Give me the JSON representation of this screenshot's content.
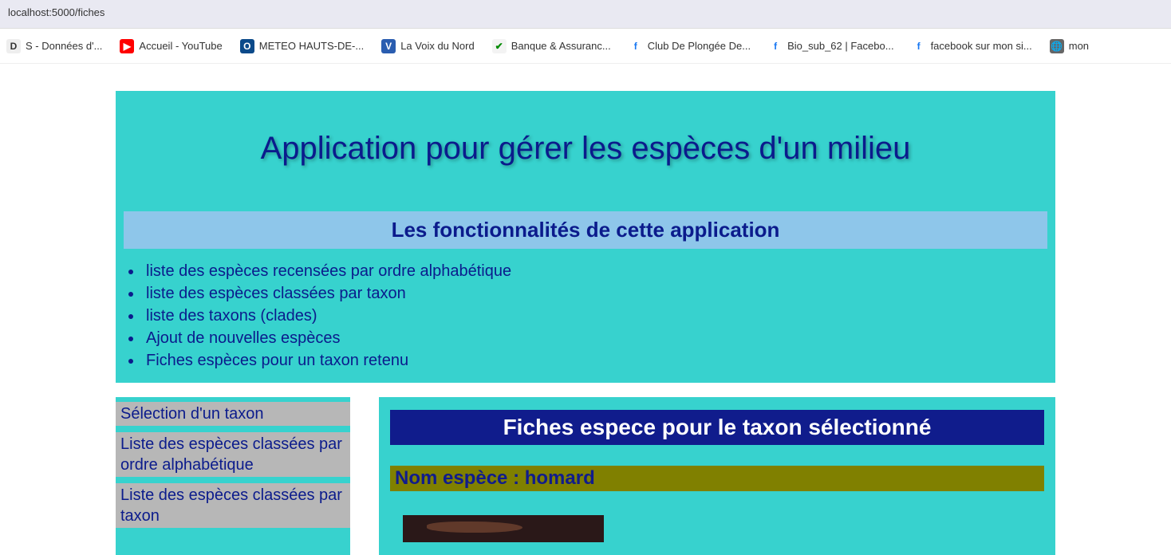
{
  "browser": {
    "url": "localhost:5000/fiches",
    "bookmarks": [
      {
        "label": "S - Données d'...",
        "icon_class": "ic-doc",
        "glyph": "D"
      },
      {
        "label": "Accueil - YouTube",
        "icon_class": "ic-yt",
        "glyph": "▶"
      },
      {
        "label": "METEO HAUTS-DE-...",
        "icon_class": "ic-meteo",
        "glyph": "O"
      },
      {
        "label": "La Voix du Nord",
        "icon_class": "ic-voix",
        "glyph": "V"
      },
      {
        "label": "Banque & Assuranc...",
        "icon_class": "ic-ca",
        "glyph": "✔"
      },
      {
        "label": "Club De Plongée De...",
        "icon_class": "ic-fb",
        "glyph": "f"
      },
      {
        "label": "Bio_sub_62 | Facebo...",
        "icon_class": "ic-fb",
        "glyph": "f"
      },
      {
        "label": "facebook sur mon si...",
        "icon_class": "ic-fb",
        "glyph": "f"
      },
      {
        "label": "mon",
        "icon_class": "ic-globe",
        "glyph": "🌐"
      }
    ]
  },
  "header": {
    "title": "Application pour gérer les espèces d'un milieu",
    "features_heading": "Les fonctionnalités de cette application",
    "features": [
      "liste des espèces recensées par ordre alphabétique",
      "liste des espèces classées par taxon",
      "liste des taxons (clades)",
      "Ajout de nouvelles espèces",
      "Fiches espèces pour un taxon retenu"
    ]
  },
  "sidebar": {
    "items": [
      "Sélection d'un taxon",
      "Liste des espèces classées par ordre alphabétique",
      "Liste des espèces classées par taxon"
    ]
  },
  "main": {
    "panel_title": "Fiches espece pour le taxon sélectionné",
    "species_label": "Nom espèce : homard"
  }
}
